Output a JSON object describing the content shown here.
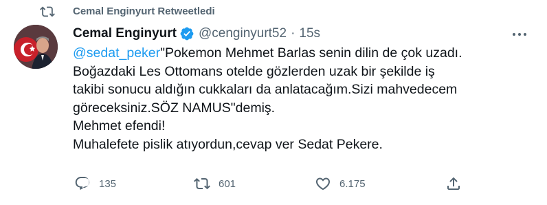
{
  "retweet_banner": {
    "text": "Cemal Enginyurt Retweetledi"
  },
  "tweet": {
    "display_name": "Cemal Enginyurt",
    "handle": "@cenginyurt52",
    "separator": "·",
    "time": "15s",
    "mention": "@sedat_peker",
    "lines": [
      "\"Pokemon Mehmet Barlas senin dilin de çok uzadı.",
      "Boğazdaki Les Ottomans otelde gözlerden uzak bir şekilde iş",
      "takibi sonucu aldığın cukkaları da anlatacağım.Sizi mahvedecem",
      "göreceksiniz.SÖZ NAMUS\"demiş.",
      "Mehmet efendi!",
      "Muhalefete pislik atıyordun,cevap ver Sedat Pekere."
    ]
  },
  "actions": {
    "reply_count": "135",
    "retweet_count": "601",
    "like_count": "6.175"
  },
  "colors": {
    "accent": "#1d9bf0",
    "muted": "#536471",
    "text": "#0f1419"
  },
  "icons": [
    "retweet-icon",
    "verified-badge-icon",
    "more-icon",
    "reply-icon",
    "like-icon",
    "share-icon"
  ]
}
